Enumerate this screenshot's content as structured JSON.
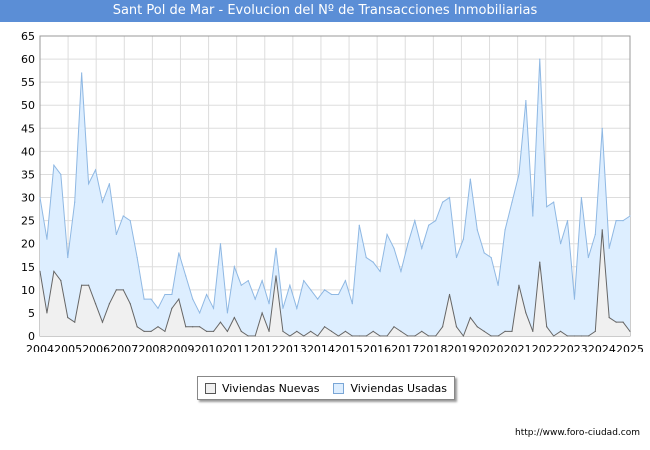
{
  "title": "Sant Pol de Mar - Evolucion del Nº de Transacciones Inmobiliarias",
  "source": "http://www.foro-ciudad.com",
  "colors": {
    "title_bg": "#5b8ed6",
    "usadas_fill": "#ddeeff",
    "usadas_line": "#8fb8e3",
    "nuevas_fill": "#f0f0f0",
    "nuevas_line": "#666666",
    "grid": "#dddddd"
  },
  "legend": {
    "nuevas": "Viviendas Nuevas",
    "usadas": "Viviendas Usadas"
  },
  "chart_data": {
    "type": "area",
    "x_labels": [
      "2004",
      "2005",
      "2006",
      "2007",
      "2008",
      "2009",
      "2010",
      "2011",
      "2012",
      "2013",
      "2014",
      "2015",
      "2016",
      "2017",
      "2018",
      "2019",
      "2020",
      "2021",
      "2022",
      "2023",
      "2024",
      "2025"
    ],
    "ylim": [
      0,
      65
    ],
    "yticks": [
      0,
      5,
      10,
      15,
      20,
      25,
      30,
      35,
      40,
      45,
      50,
      55,
      60,
      65
    ],
    "grid": true,
    "legend_position": "bottom",
    "series": [
      {
        "name": "Viviendas Usadas",
        "values": [
          30,
          21,
          37,
          35,
          17,
          29,
          57,
          33,
          36,
          29,
          33,
          22,
          26,
          25,
          17,
          8,
          8,
          6,
          9,
          9,
          18,
          13,
          8,
          5,
          9,
          6,
          20,
          5,
          15,
          11,
          12,
          8,
          12,
          7,
          19,
          6,
          11,
          6,
          12,
          10,
          8,
          10,
          9,
          9,
          12,
          7,
          24,
          17,
          16,
          14,
          22,
          19,
          14,
          20,
          25,
          19,
          24,
          25,
          29,
          30,
          17,
          21,
          34,
          23,
          18,
          17,
          11,
          23,
          29,
          35,
          51,
          26,
          60,
          28,
          29,
          20,
          25,
          8,
          30,
          17,
          22,
          45,
          19,
          25,
          25,
          26
        ]
      },
      {
        "name": "Viviendas Nuevas",
        "values": [
          14,
          5,
          14,
          12,
          4,
          3,
          11,
          11,
          7,
          3,
          7,
          10,
          10,
          7,
          2,
          1,
          1,
          2,
          1,
          6,
          8,
          2,
          2,
          2,
          1,
          1,
          3,
          1,
          4,
          1,
          0,
          0,
          5,
          1,
          13,
          1,
          0,
          1,
          0,
          1,
          0,
          2,
          1,
          0,
          1,
          0,
          0,
          0,
          1,
          0,
          0,
          2,
          1,
          0,
          0,
          1,
          0,
          0,
          2,
          9,
          2,
          0,
          4,
          2,
          1,
          0,
          0,
          1,
          1,
          11,
          5,
          1,
          16,
          2,
          0,
          1,
          0,
          0,
          0,
          0,
          1,
          23,
          4,
          3,
          3,
          1
        ]
      }
    ]
  }
}
